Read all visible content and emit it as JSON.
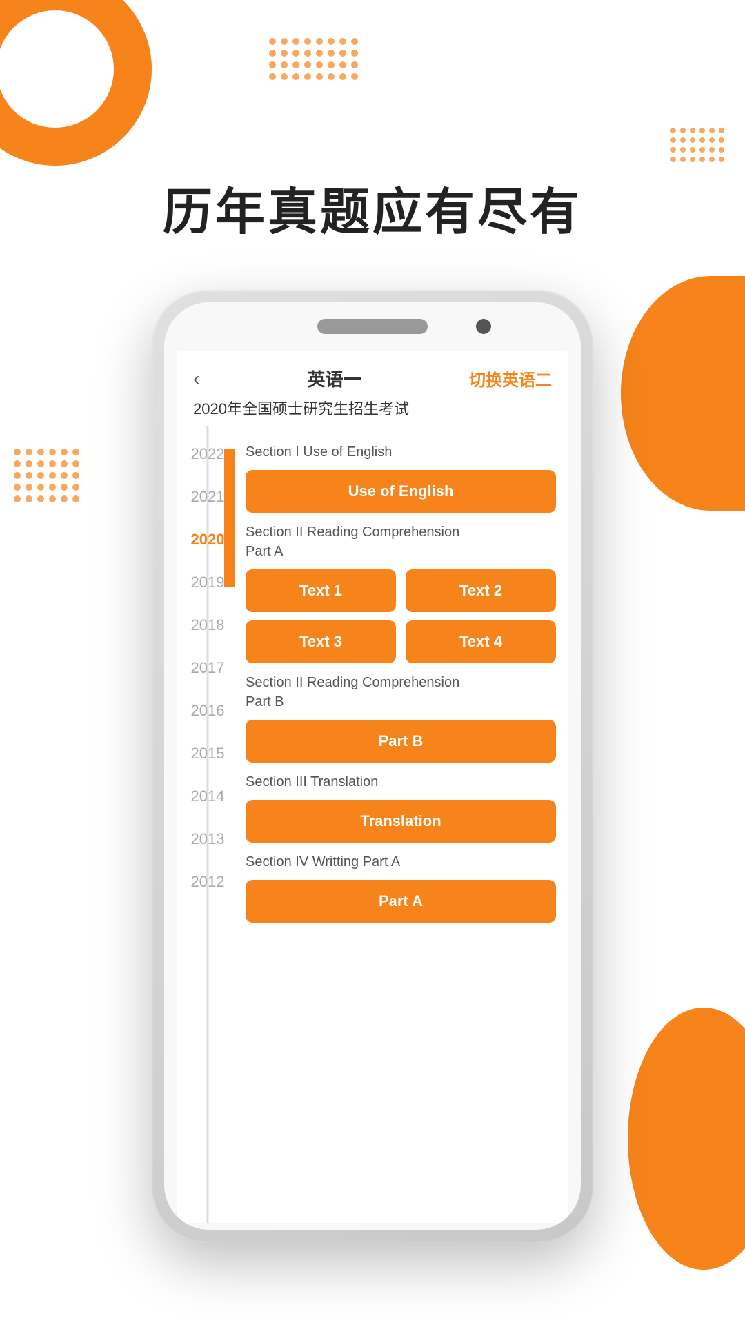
{
  "page": {
    "background_color": "#ffffff",
    "accent_color": "#f7841a"
  },
  "decorative": {
    "dots_grid_label": "dot-grid-decoration"
  },
  "main_title": "历年真题应有尽有",
  "phone": {
    "screen": {
      "nav": {
        "back_icon": "‹",
        "title": "英语一",
        "switch_label": "切换英语二"
      },
      "subtitle": "2020年全国硕士研究生招生考试",
      "years": [
        {
          "year": "2022",
          "active": false
        },
        {
          "year": "2021",
          "active": false
        },
        {
          "year": "2020",
          "active": true
        },
        {
          "year": "2019",
          "active": false
        },
        {
          "year": "2018",
          "active": false
        },
        {
          "year": "2017",
          "active": false
        },
        {
          "year": "2016",
          "active": false
        },
        {
          "year": "2015",
          "active": false
        },
        {
          "year": "2014",
          "active": false
        },
        {
          "year": "2013",
          "active": false
        },
        {
          "year": "2012",
          "active": false
        }
      ],
      "sections": [
        {
          "id": "section1",
          "label": "Section I Use of English",
          "buttons": [
            {
              "id": "btn-use-of-english",
              "label": "Use of English",
              "full": true
            }
          ]
        },
        {
          "id": "section2",
          "label": "Section II Reading Comprehension\nPart A",
          "buttons": [
            {
              "id": "btn-text1",
              "label": "Text 1",
              "full": false
            },
            {
              "id": "btn-text2",
              "label": "Text 2",
              "full": false
            },
            {
              "id": "btn-text3",
              "label": "Text 3",
              "full": false
            },
            {
              "id": "btn-text4",
              "label": "Text 4",
              "full": false
            }
          ]
        },
        {
          "id": "section3",
          "label": "Section II Reading Comprehension\nPart B",
          "buttons": [
            {
              "id": "btn-partb",
              "label": "Part B",
              "full": true
            }
          ]
        },
        {
          "id": "section4",
          "label": "Section III Translation",
          "buttons": [
            {
              "id": "btn-translation",
              "label": "Translation",
              "full": true
            }
          ]
        },
        {
          "id": "section5",
          "label": "Section IV Writting Part A",
          "buttons": [
            {
              "id": "btn-parta",
              "label": "Part A",
              "full": true
            }
          ]
        }
      ]
    }
  }
}
